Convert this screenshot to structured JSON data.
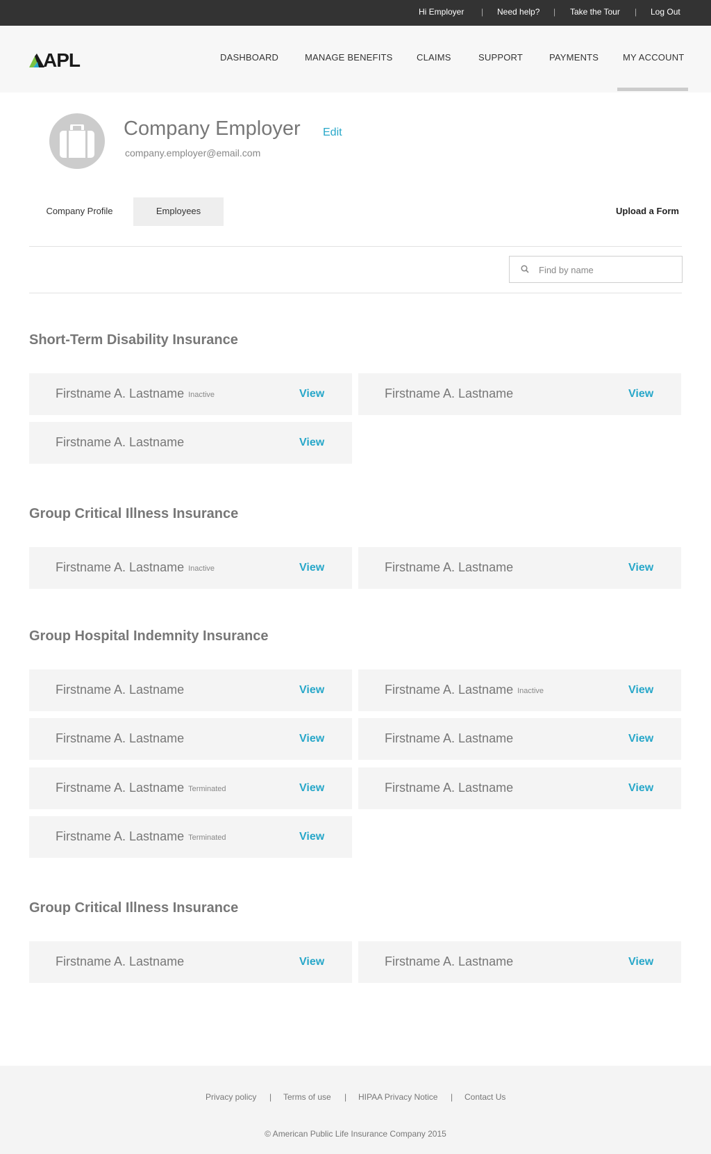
{
  "topbar": {
    "greeting": "Hi Employer",
    "help": "Need help?",
    "tour": "Take the Tour",
    "logout": "Log Out",
    "separator": "|"
  },
  "brand": {
    "logo_text": "APL",
    "logo_colors": [
      "#7cc243",
      "#27a7c9",
      "#1a1a1a"
    ]
  },
  "nav": {
    "items": [
      "DASHBOARD",
      "MANAGE BENEFITS",
      "CLAIMS",
      "SUPPORT",
      "PAYMENTS",
      "MY ACCOUNT"
    ],
    "active": "MY ACCOUNT"
  },
  "profile": {
    "name": "Company Employer",
    "edit": "Edit",
    "email": "company.employer@email.com",
    "avatar_icon": "briefcase-icon"
  },
  "tabs": {
    "items": [
      "Company Profile",
      "Employees"
    ],
    "active": "Employees",
    "upload": "Upload a Form"
  },
  "search": {
    "placeholder": "Find by name",
    "value": "",
    "icon": "search-icon"
  },
  "sections": [
    {
      "title": "Short-Term Disability Insurance",
      "employees": [
        {
          "name": "Firstname A. Lastname",
          "status": "Inactive",
          "action": "View"
        },
        {
          "name": "Firstname A. Lastname",
          "status": "",
          "action": "View"
        },
        {
          "name": "Firstname A. Lastname",
          "status": "",
          "action": "View"
        }
      ]
    },
    {
      "title": "Group Critical Illness Insurance",
      "employees": [
        {
          "name": "Firstname A. Lastname",
          "status": "Inactive",
          "action": "View"
        },
        {
          "name": "Firstname A. Lastname",
          "status": "",
          "action": "View"
        }
      ]
    },
    {
      "title": "Group Hospital Indemnity Insurance",
      "employees": [
        {
          "name": "Firstname A. Lastname",
          "status": "",
          "action": "View"
        },
        {
          "name": "Firstname A. Lastname",
          "status": "Inactive",
          "action": "View"
        },
        {
          "name": "Firstname A. Lastname",
          "status": "",
          "action": "View"
        },
        {
          "name": "Firstname A. Lastname",
          "status": "",
          "action": "View"
        },
        {
          "name": "Firstname A. Lastname",
          "status": "Terminated",
          "action": "View"
        },
        {
          "name": "Firstname A. Lastname",
          "status": "",
          "action": "View"
        },
        {
          "name": "Firstname A. Lastname",
          "status": "Terminated",
          "action": "View"
        }
      ]
    },
    {
      "title": "Group Critical Illness Insurance",
      "employees": [
        {
          "name": "Firstname A. Lastname",
          "status": "",
          "action": "View"
        },
        {
          "name": "Firstname A. Lastname",
          "status": "",
          "action": "View"
        }
      ]
    }
  ],
  "footer": {
    "links": [
      "Privacy policy",
      "Terms of use",
      "HIPAA Privacy Notice",
      "Contact Us"
    ],
    "separator": "|",
    "copyright": "© American Public Life Insurance Company 2015"
  },
  "colors": {
    "accent": "#27a7c9",
    "topbar_bg": "#333333",
    "header_bg": "#f7f7f7",
    "card_bg": "#f4f4f4"
  }
}
